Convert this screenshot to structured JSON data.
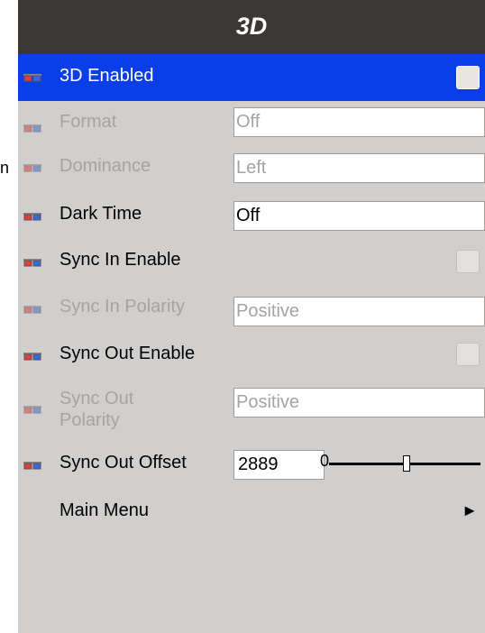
{
  "title": "3D",
  "stray_text": "n",
  "icon": "3d-glasses-icon",
  "colors": {
    "titlebar": "#3b3735",
    "selected_row": "#0a3ee8",
    "panel": "#d1cfcd",
    "disabled_text": "#a6a3a1"
  },
  "items": {
    "enabled": {
      "label": "3D Enabled",
      "checked": false
    },
    "format": {
      "label": "Format",
      "value": "Off"
    },
    "dominance": {
      "label": "Dominance",
      "value": "Left"
    },
    "dark_time": {
      "label": "Dark Time",
      "value": "Off"
    },
    "sync_in_enable": {
      "label": "Sync In Enable",
      "checked": false
    },
    "sync_in_polarity": {
      "label": "Sync In Polarity",
      "value": "Positive"
    },
    "sync_out_enable": {
      "label": "Sync Out Enable",
      "checked": false
    },
    "sync_out_polarity": {
      "label": "Sync Out Polarity",
      "value": "Positive"
    },
    "sync_out_offset": {
      "label": "Sync Out Offset",
      "value": "2889",
      "slider_min_label": "0"
    },
    "main_menu": {
      "label": "Main Menu",
      "arrow": "►"
    }
  }
}
